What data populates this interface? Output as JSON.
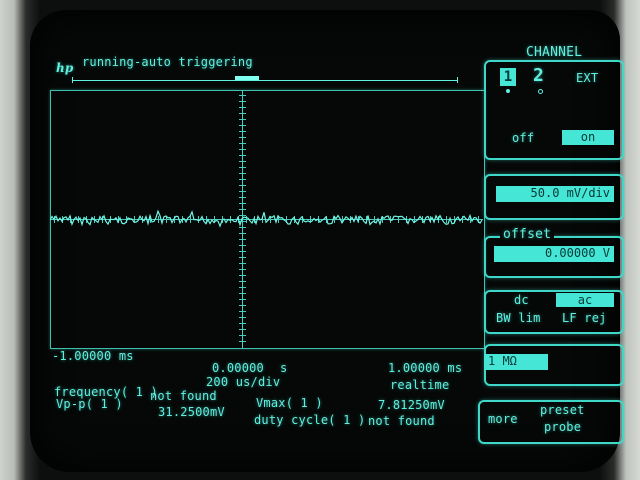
{
  "header": {
    "logo": "hp",
    "status": "running-auto triggering"
  },
  "channel_panel": {
    "title": "CHANNEL",
    "channels": [
      "1",
      "2",
      "EXT"
    ],
    "selected_channel": "1",
    "display": {
      "off_label": "off",
      "on_label": "on",
      "selected": "on"
    },
    "scale_value": "50.0 mV/div",
    "offset_label": "offset",
    "offset_value": "0.00000 V",
    "coupling": {
      "dc": "dc",
      "ac": "ac",
      "selected": "ac"
    },
    "filters": {
      "bw_lim": "BW lim",
      "lf_rej": "LF rej"
    },
    "impedance": "1 MΩ",
    "more_label": "more",
    "preset_label": "preset",
    "probe_label": "probe"
  },
  "timebase": {
    "left_time": "-1.00000 ms",
    "center_time": "0.00000",
    "center_unit": "s",
    "right_time": "1.00000 ms",
    "per_div": "200  us/div",
    "mode": "realtime"
  },
  "measurements": {
    "frequency_label": "frequency( 1 )",
    "frequency_value": "not found",
    "vpp_label": "Vp-p( 1 )",
    "vpp_value": "31.2500mV",
    "vmax_label": "Vmax( 1 )",
    "vmax_value": "7.81250mV",
    "duty_label": "duty cycle( 1 )",
    "duty_value": "not found"
  },
  "colors": {
    "phosphor": "#5ff0e0",
    "field_fill": "#46e6d6",
    "background": "#050807"
  }
}
